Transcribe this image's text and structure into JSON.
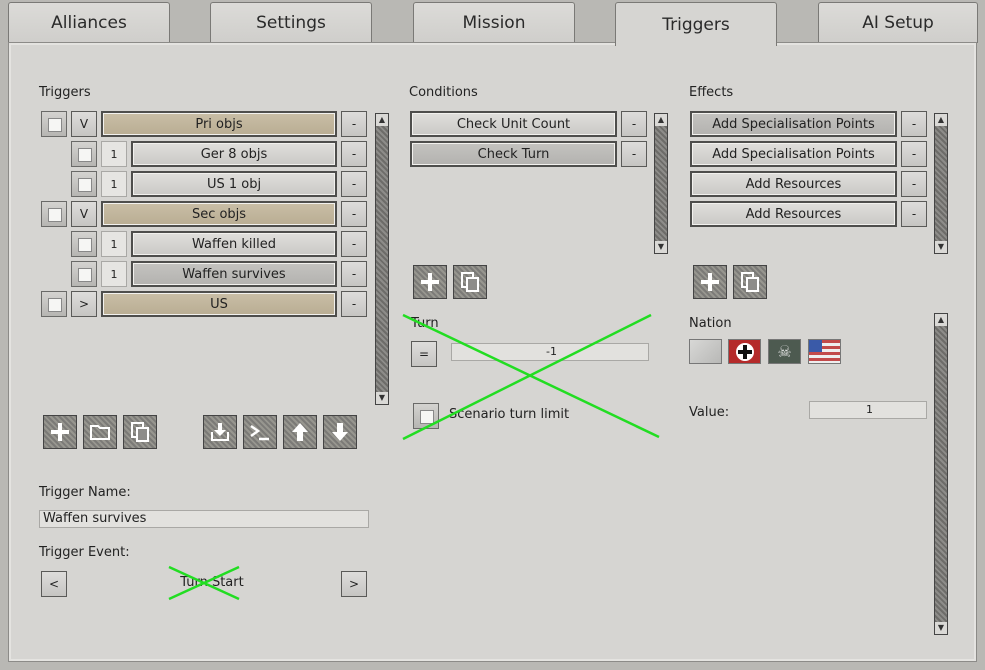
{
  "tabs": [
    {
      "label": "Alliances"
    },
    {
      "label": "Settings"
    },
    {
      "label": "Mission"
    },
    {
      "label": "Triggers",
      "active": true
    },
    {
      "label": "AI Setup"
    }
  ],
  "triggers": {
    "header": "Triggers",
    "rows": [
      {
        "indent": 0,
        "mode": "V",
        "label": "Pri objs",
        "style": "tan"
      },
      {
        "indent": 1,
        "mode": "1",
        "label": "Ger 8 objs",
        "style": "normal"
      },
      {
        "indent": 1,
        "mode": "1",
        "label": "US 1 obj",
        "style": "normal"
      },
      {
        "indent": 0,
        "mode": "V",
        "label": "Sec objs",
        "style": "tan"
      },
      {
        "indent": 1,
        "mode": "1",
        "label": "Waffen killed",
        "style": "normal"
      },
      {
        "indent": 1,
        "mode": "1",
        "label": "Waffen survives",
        "style": "selected"
      },
      {
        "indent": 0,
        "mode": ">",
        "label": "US",
        "style": "tan"
      }
    ],
    "remove_label": "-",
    "name_label": "Trigger Name:",
    "name_value": "Waffen survives",
    "event_label": "Trigger Event:",
    "event_value": "Turn Start",
    "prev_label": "<",
    "next_label": ">"
  },
  "conditions": {
    "header": "Conditions",
    "items": [
      "Check Unit Count",
      "Check Turn"
    ],
    "remove_label": "-",
    "turn_label": "Turn",
    "operator": "=",
    "turn_value": "-1",
    "scenario_turn_limit_label": "Scenario turn limit"
  },
  "effects": {
    "header": "Effects",
    "items": [
      "Add Specialisation Points",
      "Add Specialisation Points",
      "Add Resources",
      "Add Resources"
    ],
    "remove_label": "-",
    "nation_label": "Nation",
    "value_label": "Value:",
    "value": "1"
  },
  "icons": {
    "add": "plus-icon",
    "folder": "folder-icon",
    "copy": "copy-icon",
    "import": "import-icon",
    "console": "console-icon",
    "up": "arrow-up-icon",
    "down": "arrow-down-icon"
  },
  "colors": {
    "cross_out": "#22dd22",
    "tan_row": "#c2b79e",
    "panel": "#d6d5d2"
  }
}
